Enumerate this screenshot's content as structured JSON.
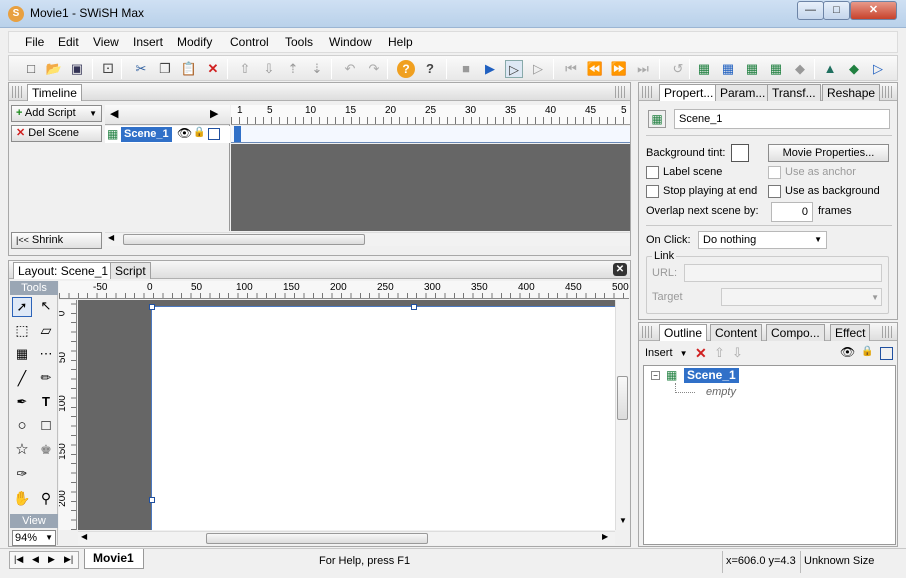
{
  "window": {
    "title": "Movie1 - SWiSH Max"
  },
  "menu": [
    "File",
    "Edit",
    "View",
    "Insert",
    "Modify",
    "Control",
    "Tools",
    "Window",
    "Help"
  ],
  "timeline": {
    "panel_title": "Timeline",
    "add_script": "Add Script",
    "del_scene": "Del Scene",
    "shrink": "Shrink",
    "scene_name": "Scene_1",
    "frame_numbers": [
      "1",
      "5",
      "10",
      "15",
      "20",
      "25",
      "30",
      "35",
      "40",
      "45",
      "5"
    ]
  },
  "layout": {
    "tabs": [
      "Layout: Scene_1",
      "Script"
    ],
    "ruler_top": [
      "-50",
      "0",
      "50",
      "100",
      "150",
      "200",
      "250",
      "300",
      "350",
      "400",
      "450",
      "500"
    ],
    "ruler_left": [
      "0",
      "50",
      "100",
      "150",
      "200"
    ],
    "tools_label": "Tools",
    "view_label": "View",
    "zoom": "94%"
  },
  "properties": {
    "tabs": [
      "Propert...",
      "Param...",
      "Transf...",
      "Reshape"
    ],
    "scene_name": "Scene_1",
    "bg_tint_label": "Background tint:",
    "movie_props_btn": "Movie Properties...",
    "label_scene": "Label scene",
    "use_as_anchor": "Use as anchor",
    "stop_playing": "Stop playing at end",
    "use_as_background": "Use as background",
    "overlap_label": "Overlap next scene by:",
    "overlap_value": "0",
    "frames": "frames",
    "on_click_label": "On Click:",
    "on_click_value": "Do nothing",
    "link_label": "Link",
    "url_label": "URL:",
    "target_label": "Target"
  },
  "outline": {
    "tabs": [
      "Outline",
      "Content",
      "Compo...",
      "Effect"
    ],
    "insert_label": "Insert",
    "scene_item": "Scene_1",
    "empty_item": "empty"
  },
  "status": {
    "movie_tab": "Movie1",
    "help": "For Help, press F1",
    "coords": "x=606.0 y=4.3",
    "size": "Unknown Size"
  }
}
